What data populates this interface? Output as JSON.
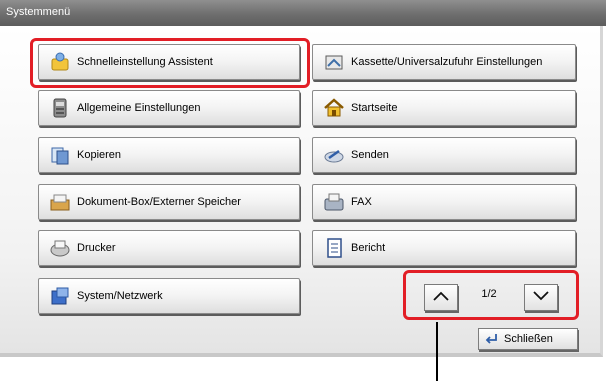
{
  "window": {
    "title": "Systemmenü"
  },
  "menu": {
    "left": [
      {
        "label": "Schnelleinstellung Assistent",
        "icon": "wizard-icon"
      },
      {
        "label": "Allgemeine Einstellungen",
        "icon": "device-icon"
      },
      {
        "label": "Kopieren",
        "icon": "copy-icon"
      },
      {
        "label": "Dokument-Box/Externer Speicher",
        "icon": "document-box-icon"
      },
      {
        "label": "Drucker",
        "icon": "printer-icon"
      },
      {
        "label": "System/Netzwerk",
        "icon": "system-network-icon"
      }
    ],
    "right": [
      {
        "label": "Kassette/Universalzufuhr Einstellungen",
        "icon": "cassette-icon"
      },
      {
        "label": "Startseite",
        "icon": "home-icon"
      },
      {
        "label": "Senden",
        "icon": "send-icon"
      },
      {
        "label": "FAX",
        "icon": "fax-icon"
      },
      {
        "label": "Bericht",
        "icon": "report-icon"
      }
    ]
  },
  "pagination": {
    "label": "1/2"
  },
  "footer": {
    "close_label": "Schließen"
  },
  "colors": {
    "highlight": "#e21e26",
    "titlebar": "#6e6e6e"
  }
}
